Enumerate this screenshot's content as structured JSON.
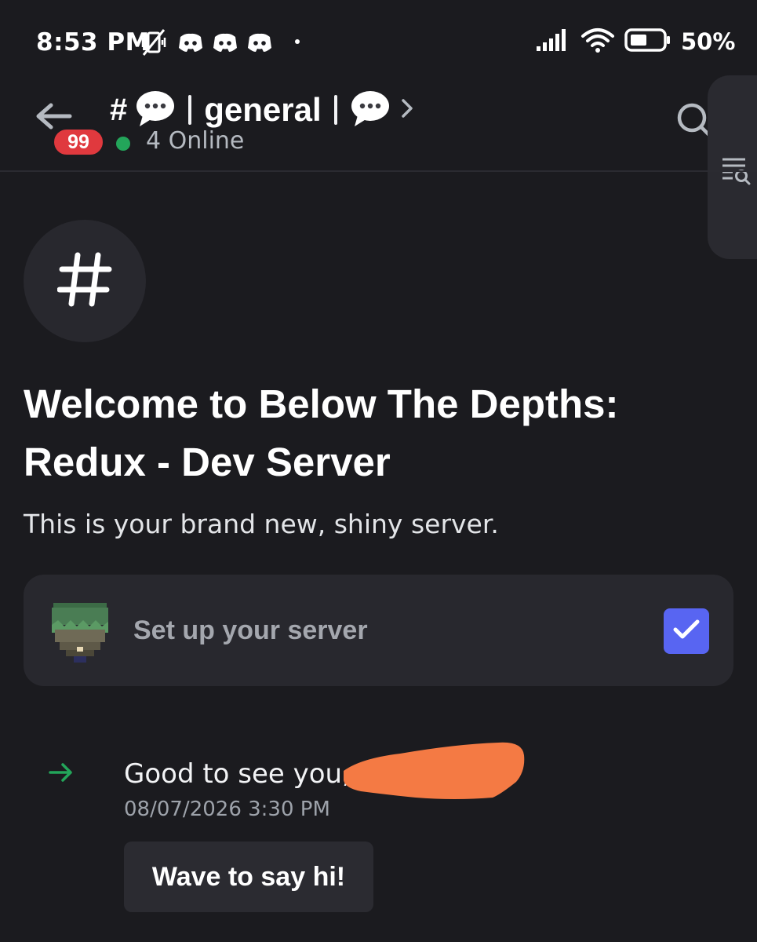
{
  "status_bar": {
    "time": "8:53 PM",
    "battery": "50%",
    "icons": [
      "vibrate-off-icon",
      "discord-icon",
      "discord-icon",
      "discord-icon",
      "signal-icon",
      "wifi-icon",
      "battery-icon"
    ]
  },
  "header": {
    "unread_badge": "99",
    "channel_prefix": "#",
    "channel_name": "general",
    "online": "4 Online",
    "icons": [
      "back-arrow-icon",
      "speech-bubble-icon",
      "chevron-right-icon",
      "search-icon",
      "list-search-icon"
    ]
  },
  "welcome": {
    "title": "Welcome to Below The Depths: Redux - Dev Server",
    "subtitle": "This is your brand new, shiny server."
  },
  "setup": {
    "label": "Set up your server"
  },
  "message": {
    "text": "Good to see you,",
    "timestamp": "08/07/2026 3:30 PM",
    "wave_button": "Wave to say hi!"
  },
  "colors": {
    "background": "#1b1b1f",
    "card": "#28282e",
    "accent": "#5865f2",
    "online": "#23a55a",
    "badge": "#e0393e",
    "join_arrow": "#23a55a",
    "redaction": "#f47a44"
  }
}
